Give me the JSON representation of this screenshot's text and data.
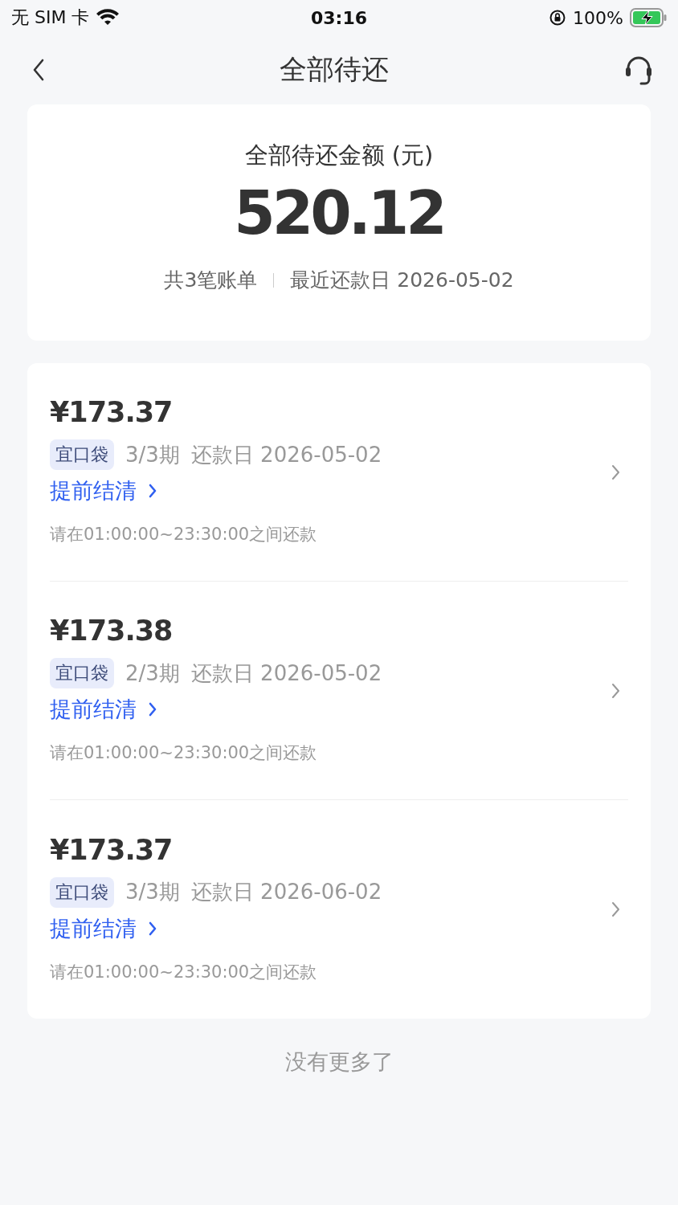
{
  "status_bar": {
    "carrier": "无 SIM 卡",
    "time": "03:16",
    "battery": "100%"
  },
  "nav": {
    "title": "全部待还"
  },
  "summary": {
    "label": "全部待还金额 (元)",
    "amount": "520.12",
    "count": "共3笔账单",
    "next_due": "最近还款日 2026-05-02"
  },
  "bills": [
    {
      "amount": "¥173.37",
      "product": "宜口袋",
      "period": "3/3期",
      "due": "还款日 2026-05-02",
      "action": "提前结清",
      "note": "请在01:00:00~23:30:00之间还款"
    },
    {
      "amount": "¥173.38",
      "product": "宜口袋",
      "period": "2/3期",
      "due": "还款日 2026-05-02",
      "action": "提前结清",
      "note": "请在01:00:00~23:30:00之间还款"
    },
    {
      "amount": "¥173.37",
      "product": "宜口袋",
      "period": "3/3期",
      "due": "还款日 2026-06-02",
      "action": "提前结清",
      "note": "请在01:00:00~23:30:00之间还款"
    }
  ],
  "footer": "没有更多了"
}
